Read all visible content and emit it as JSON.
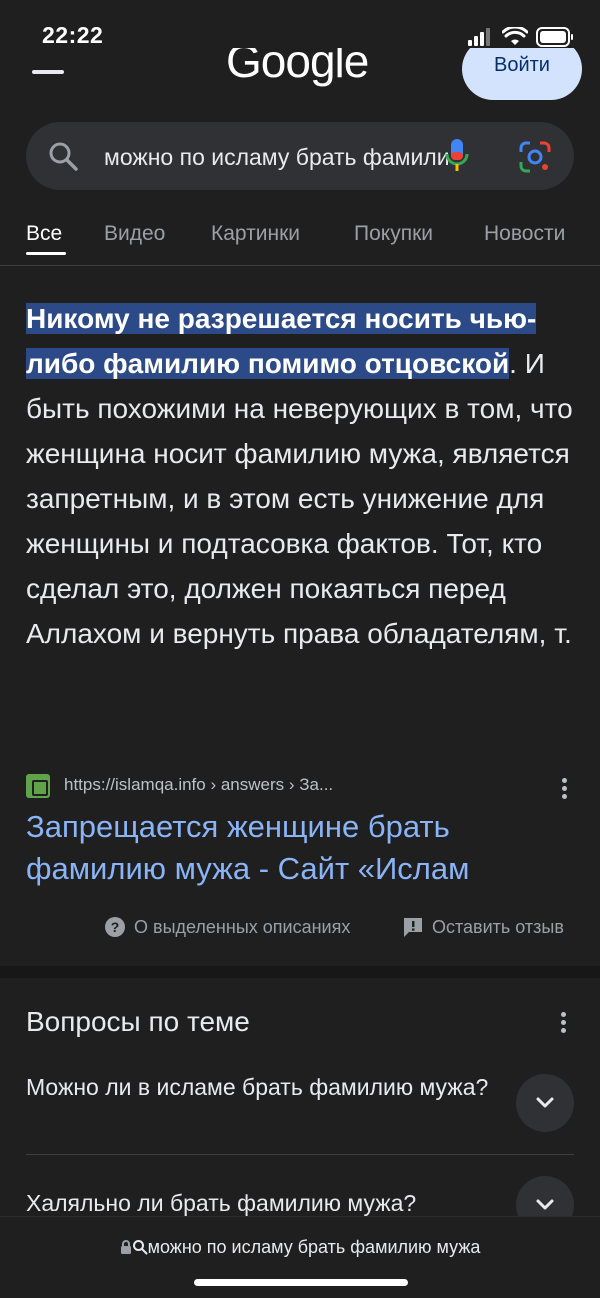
{
  "status_bar": {
    "time": "22:22"
  },
  "header": {
    "logo_text": "Google",
    "signin_label": "Войти"
  },
  "search": {
    "query": "можно по исламу брать фамилию мужа"
  },
  "tabs": [
    {
      "label": "Все"
    },
    {
      "label": "Видео"
    },
    {
      "label": "Картинки"
    },
    {
      "label": "Покупки"
    },
    {
      "label": "Новости"
    }
  ],
  "snippet": {
    "highlight": "Никому не разрешается носить чью-либо фамилию помимо отцовской",
    "rest": ". И быть похожими на неверующих в том, что женщина носит фамилию мужа, является запретным, и в этом есть унижение для женщины и подтасовка фактов. Тот, кто сделал это, должен покаяться перед Аллахом и вернуть права обладателям, т."
  },
  "source": {
    "url": "https://islamqa.info › answers › За...",
    "title": "Запрещается женщине брать фамилию мужа - Сайт «Ислам"
  },
  "footer_links": {
    "about": "О выделенных описаниях",
    "feedback": "Оставить отзыв"
  },
  "paa": {
    "title": "Вопросы по теме",
    "questions": [
      "Можно ли в исламе брать фамилию мужа?",
      "Халяльно ли брать фамилию мужа?"
    ]
  },
  "bottom_bar": {
    "url": "можно по исламу брать фамилию мужа"
  },
  "colors": {
    "background": "#1f1f1f",
    "link": "#8ab4f8",
    "highlight": "#2c4a87",
    "signin_bg": "#d3e3fd"
  }
}
